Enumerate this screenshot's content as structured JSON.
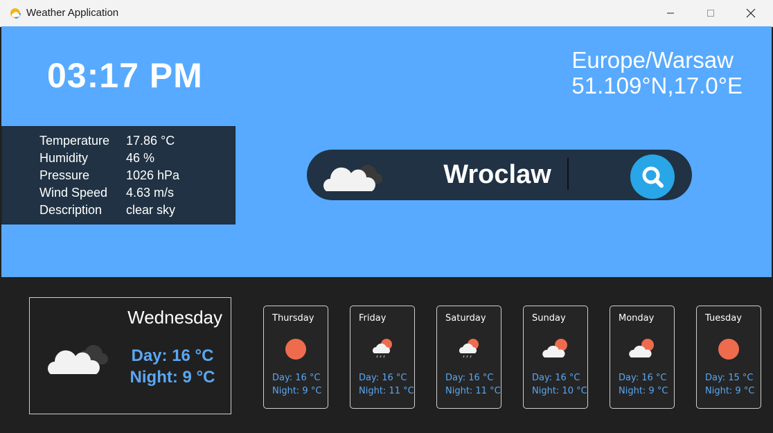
{
  "window": {
    "title": "Weather Application"
  },
  "header": {
    "time": "03:17 PM",
    "timezone": "Europe/Warsaw",
    "coordinates": "51.109°N,17.0°E"
  },
  "current": {
    "rows": [
      {
        "label": "Temperature",
        "value": "17.86 °C"
      },
      {
        "label": "Humidity",
        "value": "46 %"
      },
      {
        "label": "Pressure",
        "value": "1026 hPa"
      },
      {
        "label": "Wind Speed",
        "value": "4.63 m/s"
      },
      {
        "label": "Description",
        "value": "clear sky"
      }
    ]
  },
  "search": {
    "value": "Wroclaw",
    "icon": "search-icon"
  },
  "today": {
    "day": "Wednesday",
    "day_temp": "Day: 16 °C",
    "night_temp": "Night: 9 °C",
    "icon": "cloud-icon"
  },
  "forecast": [
    {
      "day": "Thursday",
      "day_temp": "Day: 16 °C",
      "night_temp": "Night: 9 °C",
      "icon": "sun-icon"
    },
    {
      "day": "Friday",
      "day_temp": "Day: 16 °C",
      "night_temp": "Night: 11 °C",
      "icon": "rain-icon"
    },
    {
      "day": "Saturday",
      "day_temp": "Day: 16 °C",
      "night_temp": "Night: 11 °C",
      "icon": "rain-icon"
    },
    {
      "day": "Sunday",
      "day_temp": "Day: 16 °C",
      "night_temp": "Night: 10 °C",
      "icon": "partly-cloudy-icon"
    },
    {
      "day": "Monday",
      "day_temp": "Day: 16 °C",
      "night_temp": "Night: 9 °C",
      "icon": "partly-cloudy-icon"
    },
    {
      "day": "Tuesday",
      "day_temp": "Day: 15 °C",
      "night_temp": "Night: 9 °C",
      "icon": "sun-icon"
    }
  ],
  "colors": {
    "top_bg": "#57aaff",
    "panel": "#203243",
    "bottom_bg": "#202020",
    "accent_text": "#5aa7f2",
    "search_button": "#29a6e8",
    "sun": "#ee6c4d"
  }
}
